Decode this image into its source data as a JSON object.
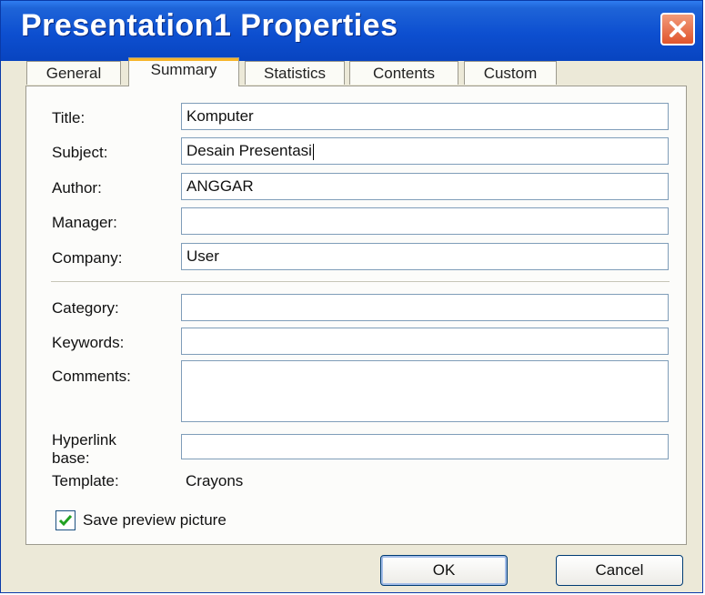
{
  "window": {
    "title": "Presentation1 Properties"
  },
  "tabs": [
    "General",
    "Summary",
    "Statistics",
    "Contents",
    "Custom"
  ],
  "active_tab": "Summary",
  "fields": {
    "title": {
      "label": "Title:",
      "value": "Komputer"
    },
    "subject": {
      "label": "Subject:",
      "value": "Desain Presentasi"
    },
    "author": {
      "label": "Author:",
      "value": "ANGGAR"
    },
    "manager": {
      "label": "Manager:",
      "value": ""
    },
    "company": {
      "label": "Company:",
      "value": "User"
    },
    "category": {
      "label": "Category:",
      "value": ""
    },
    "keywords": {
      "label": "Keywords:",
      "value": ""
    },
    "comments": {
      "label": "Comments:",
      "value": ""
    },
    "hyperlink_base": {
      "label_line1": "Hyperlink",
      "label_line2": "base:",
      "value": ""
    }
  },
  "template": {
    "label": "Template:",
    "value": "Crayons"
  },
  "save_preview": {
    "label": "Save preview picture",
    "checked": true
  },
  "buttons": {
    "ok": "OK",
    "cancel": "Cancel"
  },
  "colors": {
    "titlebar": "#0d4fd0",
    "close": "#e0542c",
    "tab_highlight": "#f7b52a",
    "dialog_bg": "#ece9d8"
  }
}
